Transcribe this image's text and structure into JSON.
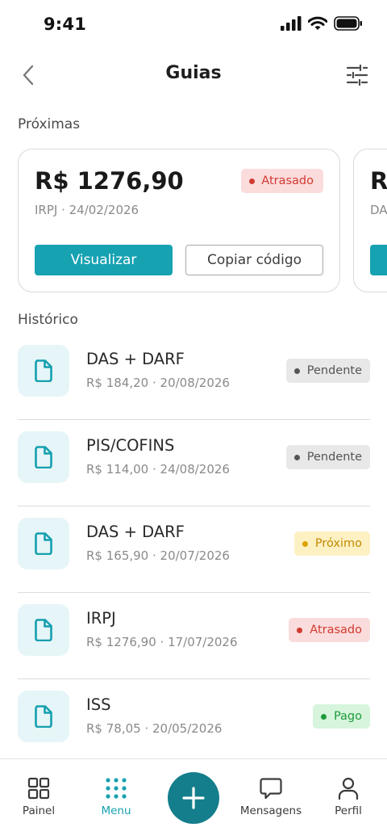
{
  "status_bar": {
    "time": "9:41"
  },
  "header": {
    "title": "Guias"
  },
  "upcoming": {
    "label": "Próximas",
    "cards": [
      {
        "amount": "R$ 1276,90",
        "subtitle": "IRPJ · 24/02/2026",
        "badge": "Atrasado",
        "view_label": "Visualizar",
        "copy_label": "Copiar código"
      },
      {
        "amount": "R$",
        "subtitle": "DA"
      }
    ]
  },
  "history": {
    "label": "Histórico",
    "items": [
      {
        "title": "DAS + DARF",
        "subtitle": "R$ 184,20 · 20/08/2026",
        "status": "Pendente",
        "status_type": "pending"
      },
      {
        "title": "PIS/COFINS",
        "subtitle": "R$ 114,00 · 24/08/2026",
        "status": "Pendente",
        "status_type": "pending"
      },
      {
        "title": "DAS + DARF",
        "subtitle": "R$ 165,90 · 20/07/2026",
        "status": "Próximo",
        "status_type": "upcoming"
      },
      {
        "title": "IRPJ",
        "subtitle": "R$ 1276,90 · 17/07/2026",
        "status": "Atrasado",
        "status_type": "late"
      },
      {
        "title": "ISS",
        "subtitle": "R$ 78,05 · 20/05/2026",
        "status": "Pago",
        "status_type": "paid"
      }
    ]
  },
  "nav": {
    "items": [
      {
        "label": "Painel",
        "icon": "grid-icon",
        "active": false
      },
      {
        "label": "Menu",
        "icon": "dots-grid-icon",
        "active": true
      },
      {
        "label": "Mensagens",
        "icon": "chat-icon",
        "active": false
      },
      {
        "label": "Perfil",
        "icon": "user-icon",
        "active": false
      }
    ],
    "fab_icon": "plus-icon"
  },
  "colors": {
    "accent": "#17a2b2",
    "fab": "#147e8c",
    "late_bg": "#fbdcdc",
    "late_fg": "#d13a30",
    "pending_bg": "#e8e8e8",
    "pending_fg": "#555555",
    "upcoming_bg": "#fdf1c4",
    "upcoming_fg": "#c48a00",
    "paid_bg": "#d6f5dc",
    "paid_fg": "#1f9a3c"
  }
}
